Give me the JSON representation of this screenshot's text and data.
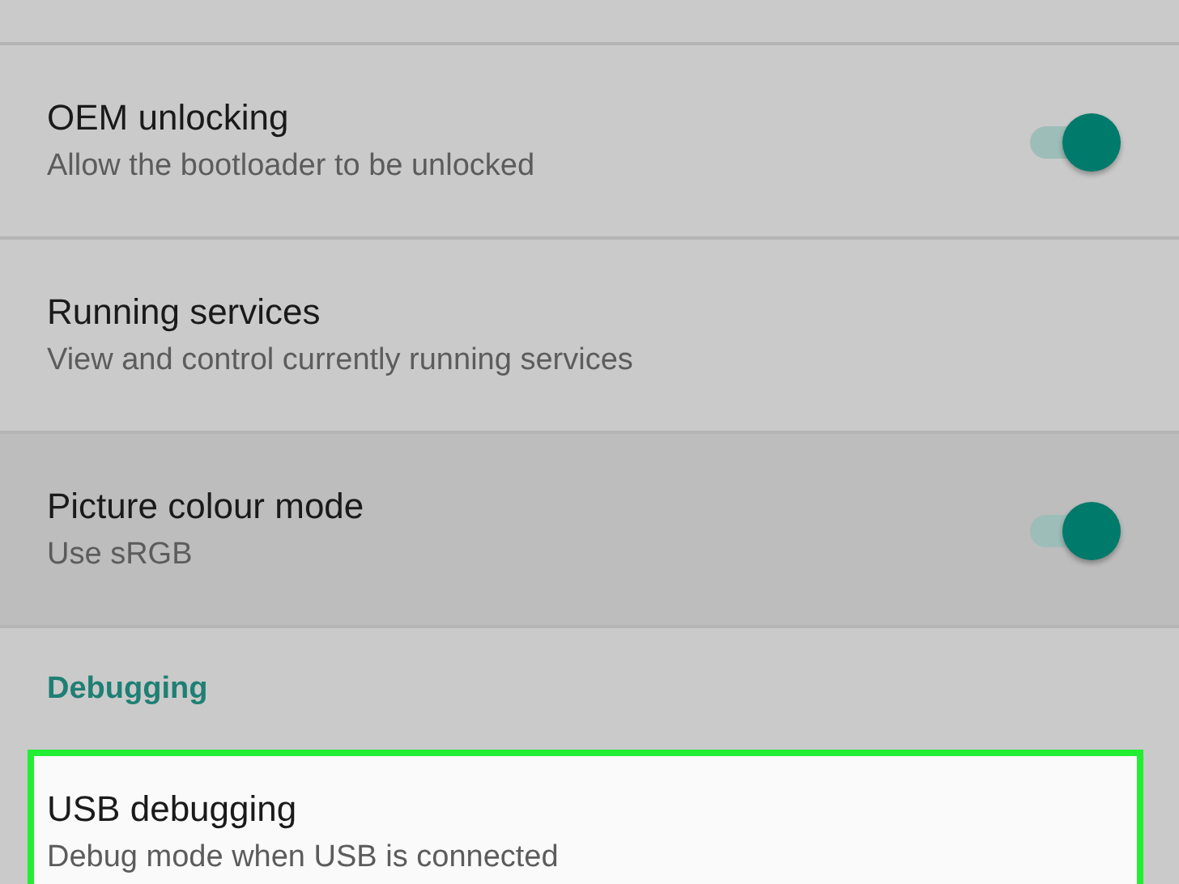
{
  "items": [
    {
      "kind": "setting",
      "title": "OEM unlocking",
      "subtitle": "Allow the bootloader to be unlocked",
      "toggle": true,
      "on": true,
      "pressed": false,
      "outlined": false
    },
    {
      "kind": "setting",
      "title": "Running services",
      "subtitle": "View and control currently running services",
      "toggle": false,
      "pressed": false,
      "outlined": false
    },
    {
      "kind": "setting",
      "title": "Picture colour mode",
      "subtitle": "Use sRGB",
      "toggle": true,
      "on": true,
      "pressed": true,
      "outlined": false
    },
    {
      "kind": "header",
      "title": "Debugging"
    },
    {
      "kind": "setting",
      "title": "USB debugging",
      "subtitle": "Debug mode when USB is connected",
      "toggle": false,
      "pressed": false,
      "outlined": true
    }
  ]
}
